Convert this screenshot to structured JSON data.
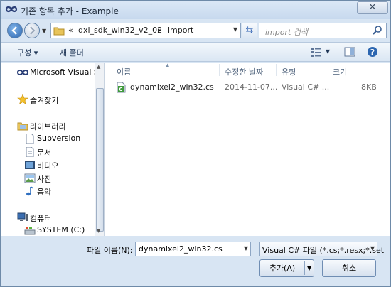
{
  "window": {
    "title": "기존 항목 추가 - Example",
    "close_label": "✕"
  },
  "address": {
    "segments": [
      "«",
      "dxl_sdk_win32_v2_02",
      "▸",
      "import"
    ]
  },
  "search": {
    "placeholder": "import 검색"
  },
  "toolbar": {
    "organize": "구성 ▾",
    "new_folder": "새 폴더"
  },
  "nav": {
    "items": [
      {
        "label": "Microsoft Visual S",
        "icon": "infinity-icon"
      },
      {
        "label": "즐겨찾기",
        "icon": "star-icon"
      },
      {
        "label": "라이브러리",
        "icon": "library-icon"
      },
      {
        "label": "Subversion",
        "icon": "document-icon"
      },
      {
        "label": "문서",
        "icon": "document-icon"
      },
      {
        "label": "비디오",
        "icon": "video-icon"
      },
      {
        "label": "사진",
        "icon": "picture-icon"
      },
      {
        "label": "음악",
        "icon": "music-icon"
      },
      {
        "label": "컴퓨터",
        "icon": "computer-icon"
      },
      {
        "label": "SYSTEM (C:)",
        "icon": "drive-icon"
      }
    ]
  },
  "files": {
    "columns": [
      "이름",
      "수정한 날짜",
      "유형",
      "크기"
    ],
    "rows": [
      {
        "name": "dynamixel2_win32.cs",
        "date": "2014-11-07...",
        "type": "Visual C# ...",
        "size": "8KB"
      }
    ]
  },
  "form": {
    "filename_label": "파일 이름(N):",
    "filename_value": "dynamixel2_win32.cs",
    "filter_value": "Visual C# 파일 (*.cs;*.resx;*.set",
    "add_label": "추가(A)",
    "cancel_label": "취소"
  },
  "colors": {
    "accent": "#2c66b0",
    "chrome": "#d8e5f3"
  }
}
